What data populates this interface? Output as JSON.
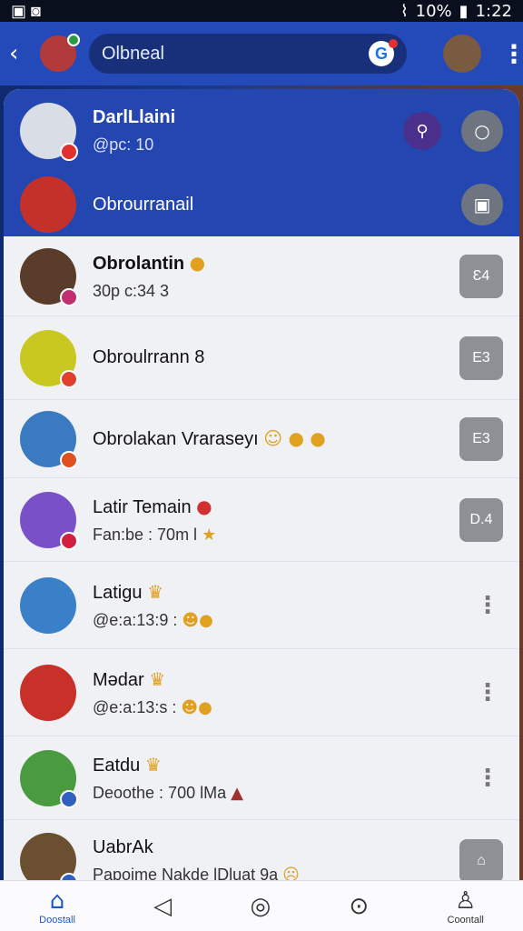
{
  "status": {
    "left_icon": "notification-icons",
    "battery": "10%",
    "time": "1:22"
  },
  "header": {
    "back": "‹",
    "search_value": "Olbneal",
    "search_badge": "G",
    "menu": "⋮",
    "left_avatar_initial": "",
    "right_avatar_initial": ""
  },
  "pinned": [
    {
      "name": "DarlLlaini",
      "sub": "@pc: 10",
      "action": "purple-person-icon",
      "action2": "chat-bubble-icon",
      "color": "#d8dde6"
    },
    {
      "name": "Obrourranail",
      "sub": "",
      "action": "square-icon",
      "color": "#c4302a"
    }
  ],
  "chats": [
    {
      "name": "Obrolantin",
      "sub": "30p c:34 3",
      "action": "Ɛ4",
      "color": "#5a3c2a",
      "badge": "#c03070"
    },
    {
      "name": "Obroulrrann 8",
      "sub": "",
      "action": "E3",
      "color": "#c8c820",
      "badge": "#e04030"
    },
    {
      "name": "Obrolakan Vraraseyı",
      "sub": "",
      "action": "E3",
      "color": "#3a7ac0",
      "badge": "#e05020"
    },
    {
      "name": "Latir Temain",
      "sub": "Fan:be : 70m l",
      "action": "D.4",
      "color": "#7a50c8",
      "badge": "#d02040"
    },
    {
      "name": "Latigu",
      "sub": "@e:a:13:9 :",
      "action": "more",
      "color": "#3a80c8",
      "badge": ""
    },
    {
      "name": "Mədar",
      "sub": "@e:a:13:s :",
      "action": "more",
      "color": "#c8302a",
      "badge": ""
    },
    {
      "name": "Eatdu",
      "sub": "Deoothe : 700 lMa",
      "action": "more",
      "color": "#4a9a40",
      "badge": "#3060c0"
    },
    {
      "name": "UabrAk",
      "sub": "Papoime  Nakde lDluat  9a",
      "action": "home-square-icon",
      "color": "#6a5030",
      "badge": "#3060c0"
    }
  ],
  "nav": {
    "home_label": "Doostall",
    "contact_label": "Coontall"
  }
}
